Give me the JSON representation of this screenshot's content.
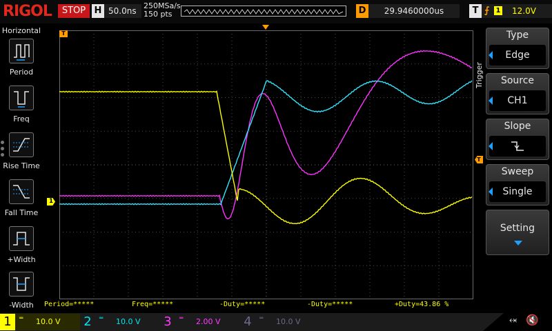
{
  "top": {
    "logo": "RIGOL",
    "run_state": "STOP",
    "h_label": "H",
    "time_scale": "50.0ns",
    "sample_rate": "250MSa/s",
    "points": "150 pts",
    "d_label": "D",
    "delay": "29.9460000us",
    "t_label": "T",
    "trigger_channel": "1",
    "trigger_level": "12.0V"
  },
  "left_panel": {
    "title": "Horizontal",
    "items": [
      {
        "label": "Period",
        "icon": "period-icon"
      },
      {
        "label": "Freq",
        "icon": "freq-icon"
      },
      {
        "label": "Rise Time",
        "icon": "rise-time-icon"
      },
      {
        "label": "Fall Time",
        "icon": "fall-time-icon"
      },
      {
        "label": "+Width",
        "icon": "plus-width-icon"
      },
      {
        "label": "-Width",
        "icon": "minus-width-icon"
      }
    ]
  },
  "markers": {
    "trigger_pos": "T",
    "trigger_level": "T",
    "ch1": "1"
  },
  "menu": {
    "title": "Trigger",
    "type_title": "Type",
    "type_value": "Edge",
    "source_title": "Source",
    "source_value": "CH1",
    "slope_title": "Slope",
    "slope_value": "⦩",
    "sweep_title": "Sweep",
    "sweep_value": "Single",
    "setting_title": "Setting"
  },
  "readout": {
    "period": "Period=*****",
    "freq": "Freq=*****",
    "minus_duty": "-Duty=*****",
    "minus_duty2": "-Duty=*****",
    "plus_duty": "+Duty=43.86 %"
  },
  "channels": [
    {
      "num": "1",
      "scale": "10.0 V",
      "color": "#ffff00"
    },
    {
      "num": "2",
      "scale": "10.0 V",
      "color": "#00e5ee"
    },
    {
      "num": "3",
      "scale": "2.00 V",
      "color": "#ff3cff"
    },
    {
      "num": "4",
      "scale": "10.0 V",
      "color": "#6a6a8a"
    }
  ],
  "colors": {
    "ch1": "#ffff00",
    "ch2": "#33e6ff",
    "ch3": "#ff33ff",
    "accent": "#ff9c00",
    "stop": "#c8171a"
  }
}
